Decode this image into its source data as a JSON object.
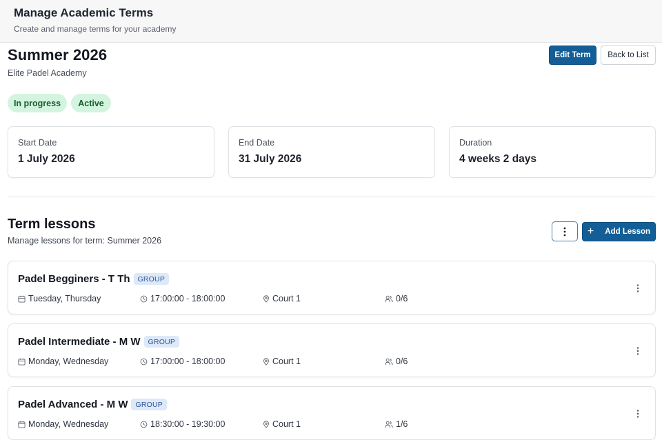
{
  "header": {
    "title": "Manage Academic Terms",
    "subtitle": "Create and manage terms for your academy"
  },
  "term": {
    "name": "Summer 2026",
    "academy": "Elite Padel Academy",
    "badges": [
      "In progress",
      "Active"
    ],
    "edit_label": "Edit Term",
    "back_label": "Back to List"
  },
  "stats": [
    {
      "label": "Start Date",
      "value": "1 July 2026"
    },
    {
      "label": "End Date",
      "value": "31 July 2026"
    },
    {
      "label": "Duration",
      "value": "4 weeks 2 days"
    }
  ],
  "lessons_section": {
    "title": "Term lessons",
    "subtitle": "Manage lessons for term: Summer 2026",
    "add_label": "Add Lesson",
    "add_icon": "plus-icon",
    "more_icon": "vertical-ellipsis-icon"
  },
  "lessons": [
    {
      "name": "Padel Begginers - T Th",
      "tag": "GROUP",
      "days": "Tuesday, Thursday",
      "time": "17:00:00 - 18:00:00",
      "court": "Court 1",
      "seats": "0/6"
    },
    {
      "name": "Padel Intermediate - M W",
      "tag": "GROUP",
      "days": "Monday, Wednesday",
      "time": "17:00:00 - 18:00:00",
      "court": "Court 1",
      "seats": "0/6"
    },
    {
      "name": "Padel Advanced - M W",
      "tag": "GROUP",
      "days": "Monday, Wednesday",
      "time": "18:30:00 - 19:30:00",
      "court": "Court 1",
      "seats": "1/6"
    }
  ],
  "icons": {
    "days": "calendar-icon",
    "time": "clock-icon",
    "court": "map-pin-icon",
    "seats": "users-icon",
    "row_menu": "vertical-ellipsis-icon"
  },
  "colors": {
    "primary": "#135e96",
    "badge_bg": "#d3f5df",
    "badge_text": "#1b5c32",
    "tag_bg": "#dde8f8",
    "tag_text": "#2e5591"
  }
}
